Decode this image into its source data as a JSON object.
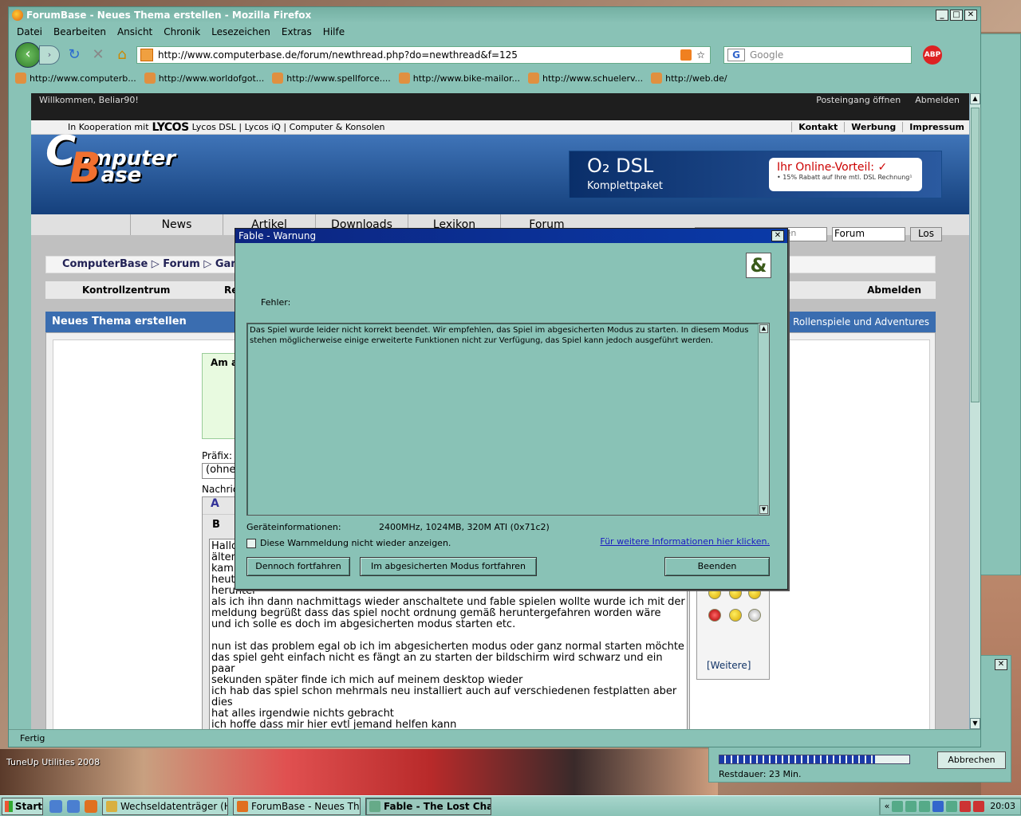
{
  "desktop": {
    "tuneup_label": "TuneUp Utilities 2008"
  },
  "bg_dialog": {
    "rest_label": "Restdauer: 23 Min.",
    "cancel_label": "Abbrechen",
    "progress": 0.82
  },
  "firefox": {
    "title": "ForumBase - Neues Thema erstellen - Mozilla Firefox",
    "menu": [
      "Datei",
      "Bearbeiten",
      "Ansicht",
      "Chronik",
      "Lesezeichen",
      "Extras",
      "Hilfe"
    ],
    "url": "http://www.computerbase.de/forum/newthread.php?do=newthread&f=125",
    "search_placeholder": "Google",
    "abp_label": "ABP",
    "bookmarks": [
      "http://www.computerb...",
      "http://www.worldofgot...",
      "http://www.spellforce....",
      "http://www.bike-mailor...",
      "http://www.schuelerv...",
      "http://web.de/"
    ],
    "status": "Fertig"
  },
  "page": {
    "welcome": "Willkommen, Beliar90!",
    "top_links": [
      "Posteingang öffnen",
      "Abmelden"
    ],
    "coop_prefix": "In Kooperation mit",
    "coop_brand": "LYCOS",
    "coop_links": "Lycos DSL | Lycos iQ | Computer & Konsolen",
    "coop_right": [
      "Kontakt",
      "Werbung",
      "Impressum"
    ],
    "logo_line1": "omputer",
    "logo_line2": "ase",
    "ad_title": "O₂ DSL",
    "ad_sub": "Komplettpaket",
    "ad_box_title": "Ihr Online-Vorteil: ✓",
    "ad_box_text": "• 15% Rabatt auf Ihre mtl. DSL Rechnung¹",
    "nav": [
      "News",
      "Artikel",
      "Downloads",
      "Lexikon",
      "Forum"
    ],
    "search_input": "Suchbegriffe eingeben",
    "search_select": "Forum",
    "search_btn": "Los",
    "breadcrumb": "ComputerBase ▷ Forum ▷ Games",
    "menu2_left": "Kontrollzentrum",
    "menu2_mid": "Re",
    "menu2_right": "Abmelden",
    "box_title": "Neues Thema erstellen",
    "box_right": "n: Rollenspiele und Adventures",
    "green_text": "Am a",
    "prefix_label": "Präfix:",
    "prefix_value": "(ohne",
    "nachricht_label": "Nachric",
    "message": "Hallo\nälter\nkam\nheut\nherunter\nals ich ihn dann nachmittags wieder anschaltete und fable spielen wollte wurde ich mit der\nmeldung begrüßt dass das spiel nocht ordnung gemäß heruntergefahren worden wäre\nund ich solle es doch im abgesicherten modus starten etc.\n\nnun ist das problem egal ob ich im abgesicherten modus oder ganz normal starten möchte\ndas spiel geht einfach nicht es fängt an zu starten der bildschirm wird schwarz und ein paar\nsekunden später finde ich mich auf meinem desktop wieder\nich hab das spiel schon mehrmals neu installiert auch auf verschiedenen festplatten aber dies\nhat alles irgendwie nichts gebracht\nich hoffe dass mir hier evtl jemand helfen kann\n\nHier noch die fehlermeldung",
    "smilies_more": "[Weitere]"
  },
  "dialog": {
    "title": "Fable - Warnung",
    "error_label": "Fehler:",
    "message": "Das Spiel wurde leider nicht korrekt beendet. Wir empfehlen, das Spiel im abgesicherten Modus zu starten. In diesem Modus stehen möglicherweise einige erweiterte Funktionen nicht zur Verfügung, das Spiel kann jedoch ausgeführt werden.",
    "device_label": "Geräteinformationen:",
    "device_value": "2400MHz, 1024MB, 320M ATI  (0x71c2)",
    "checkbox_label": "Diese Warnmeldung nicht wieder anzeigen.",
    "more_link": "Für weitere Informationen hier klicken.",
    "btn_continue": "Dennoch fortfahren",
    "btn_safe": "Im abgesicherten Modus fortfahren",
    "btn_quit": "Beenden"
  },
  "taskbar": {
    "start": "Start",
    "tasks": [
      "Wechseldatenträger (H:)",
      "ForumBase - Neues Them...",
      "Fable - The Lost Cha..."
    ],
    "clock": "20:03"
  }
}
